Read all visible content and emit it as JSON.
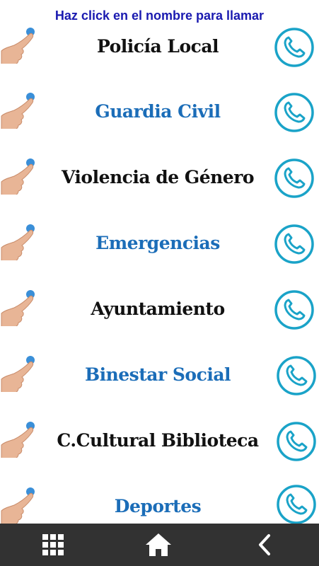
{
  "header": {
    "text": "Haz click en el nombre para llamar"
  },
  "items": [
    {
      "label": "Policía Local",
      "style": "black"
    },
    {
      "label": "Guardia Civil",
      "style": "blue"
    },
    {
      "label": "Violencia de Género",
      "style": "black"
    },
    {
      "label": "Emergencias",
      "style": "blue"
    },
    {
      "label": "Ayuntamiento",
      "style": "black"
    },
    {
      "label": "Binestar Social",
      "style": "blue"
    },
    {
      "label": "C.Cultural Biblioteca",
      "style": "black"
    },
    {
      "label": "Deportes",
      "style": "blue"
    }
  ],
  "colors": {
    "header_text": "#1a1ab0",
    "label_blue": "#1b6db8",
    "label_black": "#111111",
    "phone_icon": "#1aa3c8",
    "navbar_bg": "#323232",
    "nav_icon": "#ffffff"
  },
  "icons": {
    "row_pointer": "hand-pointer-icon",
    "row_call": "phone-icon",
    "nav_menu": "grid-menu-icon",
    "nav_home": "home-icon",
    "nav_back": "chevron-left-icon"
  }
}
